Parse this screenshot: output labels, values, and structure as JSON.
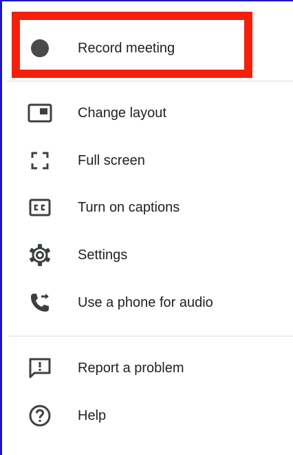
{
  "menu": {
    "items": [
      {
        "label": "Record meeting",
        "icon": "record-dot-icon"
      },
      {
        "label": "Change layout",
        "icon": "change-layout-icon"
      },
      {
        "label": "Full screen",
        "icon": "full-screen-icon"
      },
      {
        "label": "Turn on captions",
        "icon": "captions-icon"
      },
      {
        "label": "Settings",
        "icon": "gear-icon"
      },
      {
        "label": "Use a phone for audio",
        "icon": "phone-audio-icon"
      },
      {
        "label": "Report a problem",
        "icon": "report-problem-icon"
      },
      {
        "label": "Help",
        "icon": "help-icon"
      }
    ]
  },
  "colors": {
    "highlight": "#f4200c",
    "frame": "#1a16c9",
    "icon": "#3c4043",
    "record_dot": "#4a4a4a",
    "text": "#202124",
    "divider": "#dadce0"
  }
}
